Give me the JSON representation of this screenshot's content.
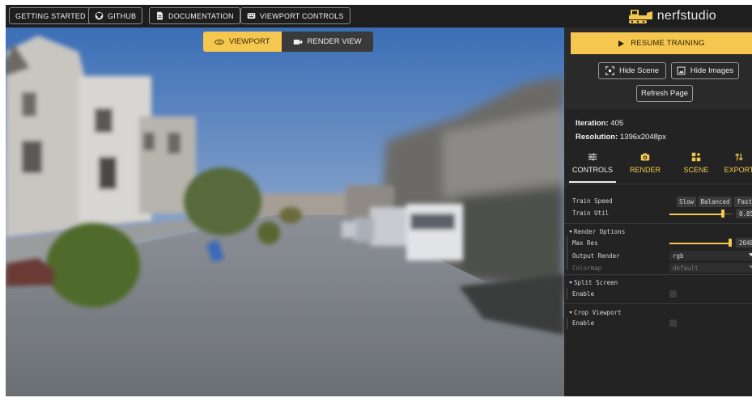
{
  "topbar": {
    "buttons": [
      {
        "label": "GETTING STARTED",
        "icon": "none"
      },
      {
        "label": "GITHUB",
        "icon": "github-icon"
      },
      {
        "label": "DOCUMENTATION",
        "icon": "document-icon"
      },
      {
        "label": "VIEWPORT CONTROLS",
        "icon": "keyboard-icon"
      }
    ],
    "brand": "nerfstudio"
  },
  "viewport": {
    "toggle": [
      {
        "label": "VIEWPORT",
        "active": true,
        "icon": "3d-rotate-icon"
      },
      {
        "label": "RENDER VIEW",
        "active": false,
        "icon": "video-icon"
      }
    ]
  },
  "panel": {
    "resume_label": "RESUME TRAINING",
    "hide_scene": "Hide Scene",
    "hide_images": "Hide Images",
    "refresh": "Refresh Page",
    "iteration_label": "Iteration:",
    "iteration_value": "405",
    "resolution_label": "Resolution:",
    "resolution_value": "1396x2048px",
    "tabs": [
      {
        "label": "CONTROLS",
        "icon": "sliders-icon",
        "active": true
      },
      {
        "label": "RENDER",
        "icon": "camera-icon",
        "active": false
      },
      {
        "label": "SCENE",
        "icon": "scene-icon",
        "active": false
      },
      {
        "label": "EXPORT",
        "icon": "export-icon",
        "active": false
      }
    ],
    "train_speed": {
      "label": "Train Speed",
      "options": [
        "Slow",
        "Balanced",
        "Fast"
      ]
    },
    "train_util": {
      "label": "Train Util",
      "value": "0.85",
      "level": 0.85
    },
    "render_options": {
      "title": "Render Options",
      "max_res": {
        "label": "Max Res",
        "value": "2048",
        "level": 0.99
      },
      "output_render": {
        "label": "Output Render",
        "value": "rgb"
      },
      "colormap": {
        "label": "Colormap",
        "value": "default"
      }
    },
    "split_screen": {
      "title": "Split Screen",
      "enable_label": "Enable"
    },
    "crop_viewport": {
      "title": "Crop Viewport",
      "enable_label": "Enable"
    }
  },
  "colors": {
    "accent": "#f5c74f",
    "panel": "#232323",
    "topbar": "#1e1e1e"
  }
}
